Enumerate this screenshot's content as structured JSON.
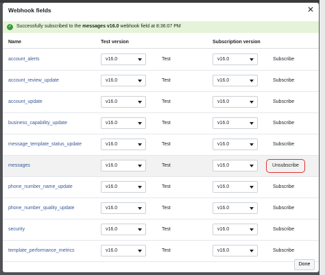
{
  "modal": {
    "title": "Webhook fields",
    "close_label": "✕",
    "banner": {
      "prefix": "Successfully subscribed to the ",
      "field": "messages v16.0",
      "suffix": " webhook field at 8:36:07 PM"
    },
    "columns": {
      "name": "Name",
      "test_version": "Test version",
      "subscription_version": "Subscription version"
    },
    "rows": [
      {
        "name": "account_alerts",
        "test_version": "v16.0",
        "test_label": "Test",
        "sub_version": "v16.0",
        "action": "Subscribe"
      },
      {
        "name": "account_review_update",
        "test_version": "v16.0",
        "test_label": "Test",
        "sub_version": "v16.0",
        "action": "Subscribe"
      },
      {
        "name": "account_update",
        "test_version": "v16.0",
        "test_label": "Test",
        "sub_version": "v16.0",
        "action": "Subscribe"
      },
      {
        "name": "business_capability_update",
        "test_version": "v16.0",
        "test_label": "Test",
        "sub_version": "v16.0",
        "action": "Subscribe"
      },
      {
        "name": "message_template_status_update",
        "test_version": "v16.0",
        "test_label": "Test",
        "sub_version": "v16.0",
        "action": "Subscribe"
      },
      {
        "name": "messages",
        "test_version": "v16.0",
        "test_label": "Test",
        "sub_version": "v16.0",
        "action": "Unsubscribe"
      },
      {
        "name": "phone_number_name_update",
        "test_version": "v16.0",
        "test_label": "Test",
        "sub_version": "v16.0",
        "action": "Subscribe"
      },
      {
        "name": "phone_number_quality_update",
        "test_version": "v16.0",
        "test_label": "Test",
        "sub_version": "v16.0",
        "action": "Subscribe"
      },
      {
        "name": "security",
        "test_version": "v16.0",
        "test_label": "Test",
        "sub_version": "v16.0",
        "action": "Subscribe"
      },
      {
        "name": "template_performance_metrics",
        "test_version": "v16.0",
        "test_label": "Test",
        "sub_version": "v16.0",
        "action": "Subscribe"
      }
    ],
    "done_label": "Done"
  },
  "colors": {
    "banner_bg": "#e5f3d8",
    "success": "#3b9b3b",
    "link": "#385898",
    "highlight_border": "#e03030"
  },
  "icons": {
    "success": "check-circle-icon",
    "close": "close-icon",
    "dropdown": "caret-down-icon"
  }
}
